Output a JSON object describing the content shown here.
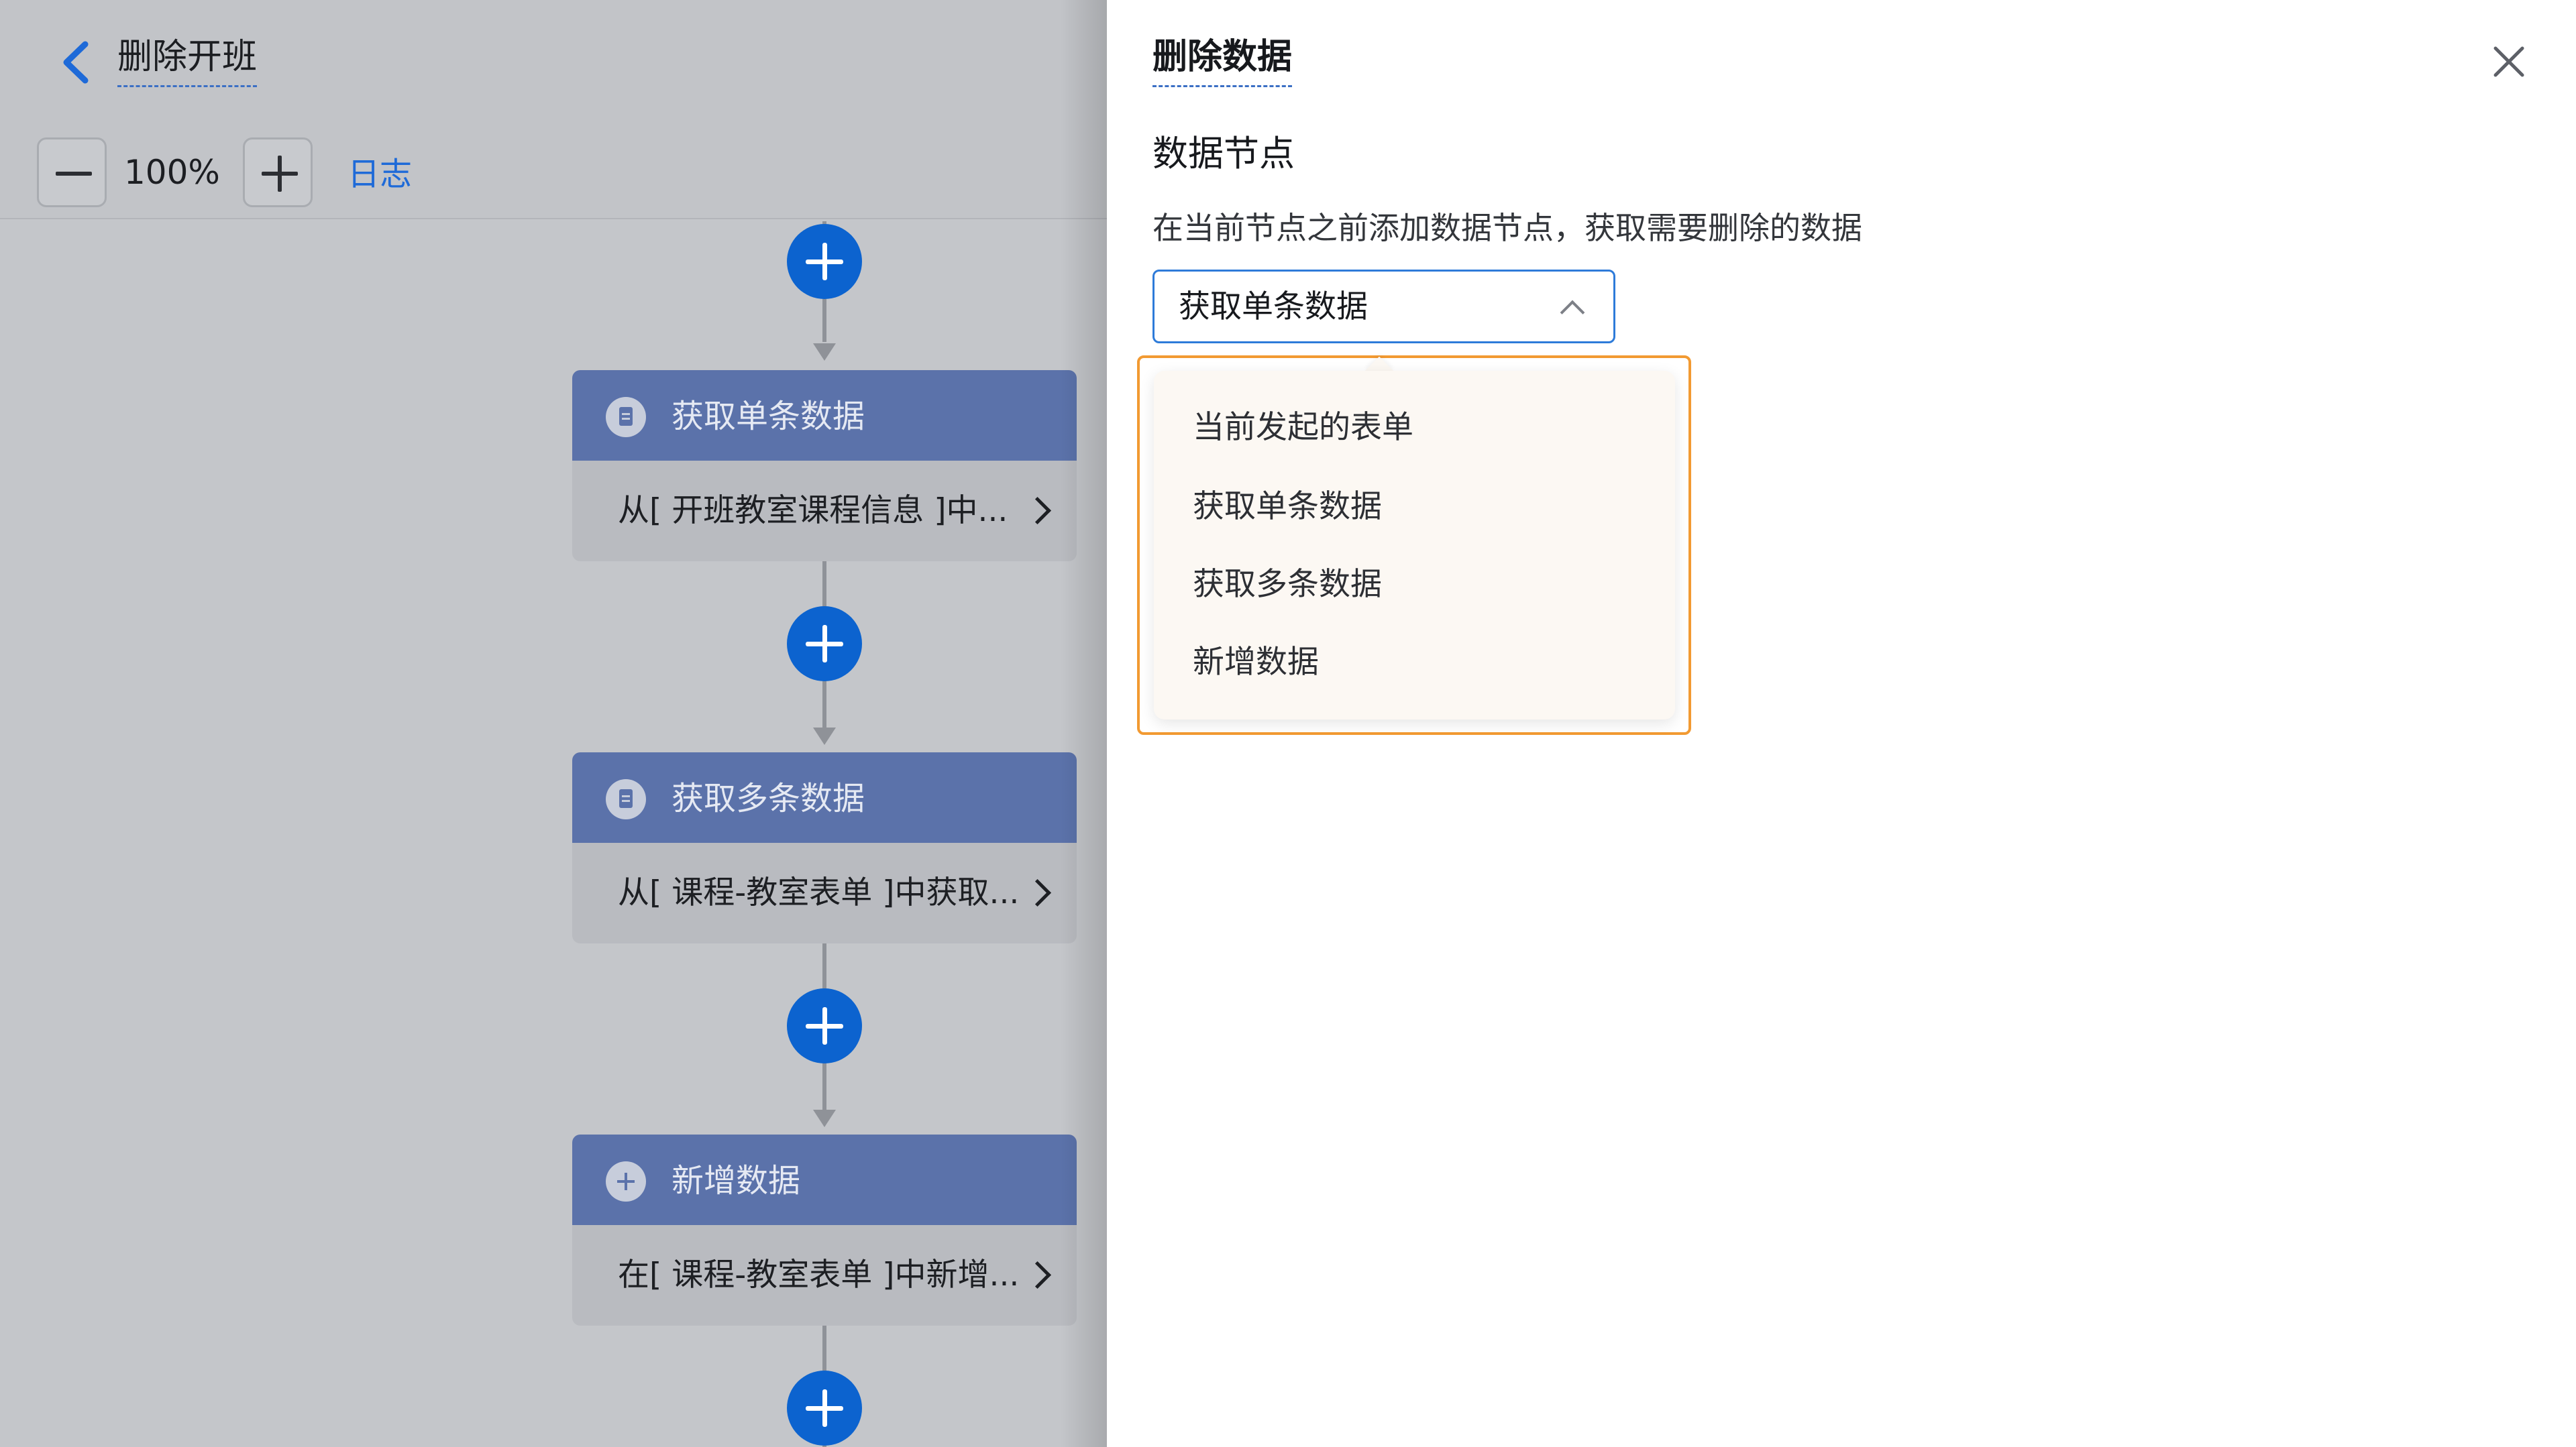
{
  "header": {
    "title": "删除开班"
  },
  "toolbar": {
    "zoom_level": "100%",
    "log_label": "日志"
  },
  "workflow": {
    "nodes": [
      {
        "title": "获取单条数据",
        "summary": "从[ 开班教室课程信息 ]中...",
        "icon": "document-icon"
      },
      {
        "title": "获取多条数据",
        "summary": "从[ 课程-教室表单 ]中获取...",
        "icon": "document-icon"
      },
      {
        "title": "新增数据",
        "summary": "在[ 课程-教室表单 ]中新增...",
        "icon": "plus-circle-icon"
      }
    ]
  },
  "drawer": {
    "title": "删除数据",
    "section_title": "数据节点",
    "description": "在当前节点之前添加数据节点，获取需要删除的数据",
    "select": {
      "value": "获取单条数据"
    },
    "options": [
      "当前发起的表单",
      "获取单条数据",
      "获取多条数据",
      "新增数据"
    ]
  },
  "colors": {
    "primary": "#0c63cf",
    "node_header": "#5b72aa",
    "highlight_outline": "#f29a32",
    "dropdown_bg": "#fcf8f3"
  }
}
